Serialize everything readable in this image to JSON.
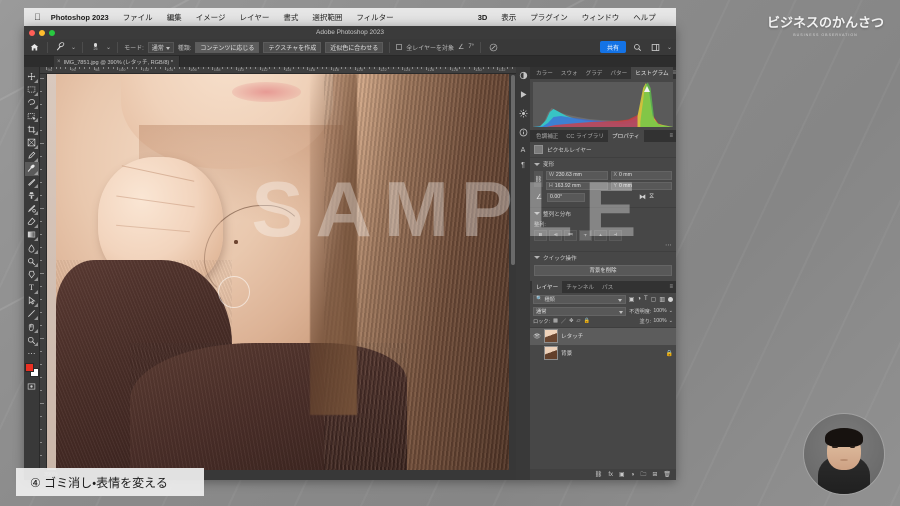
{
  "slide": {
    "caption": "④ ゴミ消し・表情を変える",
    "watermark": "SAMPLE",
    "logo_title": "ビジネスのかんさつ",
    "logo_sub": "BUSINESS OBSERVATION"
  },
  "mac_menu": {
    "apple_icon": "apple-icon",
    "app_name": "Photoshop 2023",
    "items": [
      "ファイル",
      "編集",
      "イメージ",
      "レイヤー",
      "書式",
      "選択範囲",
      "フィルター",
      "3D",
      "表示",
      "プラグイン",
      "ウィンドウ",
      "ヘルプ"
    ]
  },
  "window": {
    "title": "Adobe Photoshop 2023"
  },
  "options_bar": {
    "home_icon": "home-icon",
    "tool_icon": "spot-healing-brush-icon",
    "brush_size_icon": "brush-preset-icon",
    "brush_size_value": "25",
    "mode_label": "モード:",
    "mode_value": "通常",
    "type_label": "種類:",
    "type_buttons": [
      "コンテンツに応じる",
      "テクスチャを作成",
      "近似色に合わせる"
    ],
    "type_selected": "コンテンツに応じる",
    "all_layers_label": "全レイヤーを対象",
    "all_layers_checked": false,
    "angle_label": "∠",
    "angle_value": "7°",
    "pressure_icon": "pressure-toggle-icon",
    "share_label": "共有",
    "search_icon": "search-icon",
    "workspace_icon": "workspace-switcher-icon"
  },
  "document_tab": {
    "name": "IMG_7851.jpg @ 390% (レタッチ, RGB/8) *",
    "close_icon": "close-icon"
  },
  "tools": [
    {
      "name": "move-tool",
      "glyph": "✥"
    },
    {
      "name": "rectangular-marquee-tool",
      "glyph": "▣"
    },
    {
      "name": "lasso-tool",
      "glyph": "✎"
    },
    {
      "name": "object-selection-tool",
      "glyph": "❏"
    },
    {
      "name": "crop-tool",
      "glyph": "⌗"
    },
    {
      "name": "frame-tool",
      "glyph": "▦"
    },
    {
      "name": "eyedropper-tool",
      "glyph": "✒"
    },
    {
      "name": "spot-healing-brush-tool",
      "glyph": "✐"
    },
    {
      "name": "brush-tool",
      "glyph": "🖌"
    },
    {
      "name": "clone-stamp-tool",
      "glyph": "⎈"
    },
    {
      "name": "history-brush-tool",
      "glyph": "✜"
    },
    {
      "name": "eraser-tool",
      "glyph": "⌫"
    },
    {
      "name": "gradient-tool",
      "glyph": "▤"
    },
    {
      "name": "blur-tool",
      "glyph": "💧"
    },
    {
      "name": "dodge-tool",
      "glyph": "◌"
    },
    {
      "name": "pen-tool",
      "glyph": "✑"
    },
    {
      "name": "type-tool",
      "glyph": "T"
    },
    {
      "name": "path-selection-tool",
      "glyph": "↖"
    },
    {
      "name": "line-tool",
      "glyph": "／"
    },
    {
      "name": "hand-tool",
      "glyph": "✋"
    },
    {
      "name": "zoom-tool",
      "glyph": "🔍"
    },
    {
      "name": "edit-toolbar-tool",
      "glyph": "⋯"
    }
  ],
  "tool_selected_index": 7,
  "canvas": {
    "zoom": "390%",
    "ruler_labels": [
      "94",
      "96",
      "98",
      "100",
      "102",
      "104",
      "106",
      "108",
      "110",
      "112",
      "114",
      "116",
      "118",
      "120",
      "122",
      "124",
      "126",
      "128",
      "130",
      "132",
      "134",
      "136",
      "138",
      "140"
    ]
  },
  "right_dock_icons": [
    "adjustments-icon",
    "actions-icon",
    "styles-icon",
    "info-icon",
    "character-icon",
    "paragraph-icon"
  ],
  "histogram_panel": {
    "tabs": [
      "カラー",
      "スウォ",
      "グラデ",
      "パター",
      "ヒストグラム"
    ],
    "active_tab": "ヒストグラム",
    "menu_icon": "panel-menu-icon",
    "warning_icon": "histogram-refresh-icon"
  },
  "properties_panel": {
    "tabs": [
      "色調補正",
      "CC ライブラリ",
      "プロパティ"
    ],
    "active_tab": "プロパティ",
    "menu_icon": "panel-menu-icon",
    "layer_kind_icon": "pixel-layer-icon",
    "layer_kind": "ピクセルレイヤー",
    "transform": {
      "section_title": "変形",
      "link_icon": "link-wh-icon",
      "w_label": "W",
      "w_value": "230.63 mm",
      "h_label": "H",
      "h_value": "163.92 mm",
      "x_label": "X",
      "x_value": "0 mm",
      "y_label": "Y",
      "y_value": "0 mm",
      "angle_icon": "angle-icon",
      "angle_value": "0.00°",
      "flip_h_icon": "flip-horizontal-icon",
      "flip_v_icon": "flip-vertical-icon"
    },
    "align": {
      "section_title": "整列と分布",
      "align_label": "整列:",
      "buttons": [
        "align-left-icon",
        "align-center-h-icon",
        "align-right-icon",
        "align-top-icon",
        "align-center-v-icon",
        "align-bottom-icon"
      ],
      "more_icon": "more-options-icon"
    },
    "quick_actions": {
      "section_title": "クイック操作",
      "button_label": "背景を削除"
    }
  },
  "layers_panel": {
    "tabs": [
      "レイヤー",
      "チャンネル",
      "パス"
    ],
    "active_tab": "レイヤー",
    "menu_icon": "panel-menu-icon",
    "filter": {
      "search_icon": "search-icon",
      "kind_label": "種類",
      "filter_icons": [
        "filter-pixel-icon",
        "filter-adjustment-icon",
        "filter-type-icon",
        "filter-shape-icon",
        "filter-smart-icon"
      ],
      "toggle_icon": "filter-toggle-icon"
    },
    "blend_mode_label": "通常",
    "opacity_label": "不透明度:",
    "opacity_value": "100%",
    "lock_label": "ロック:",
    "lock_icons": [
      "lock-transparent-icon",
      "lock-image-icon",
      "lock-position-icon",
      "lock-artboard-icon",
      "lock-all-icon"
    ],
    "fill_label": "塗り:",
    "fill_value": "100%",
    "layers": [
      {
        "name": "レタッチ",
        "visible": true,
        "locked": false,
        "selected": true,
        "eye_icon": "eye-icon"
      },
      {
        "name": "背景",
        "visible": false,
        "locked": true,
        "selected": false,
        "lock_icon": "lock-icon"
      }
    ],
    "footer_icons": [
      "link-layers-icon",
      "layer-style-icon",
      "layer-mask-icon",
      "adjustment-layer-icon",
      "new-group-icon",
      "new-layer-icon",
      "delete-layer-icon"
    ]
  }
}
